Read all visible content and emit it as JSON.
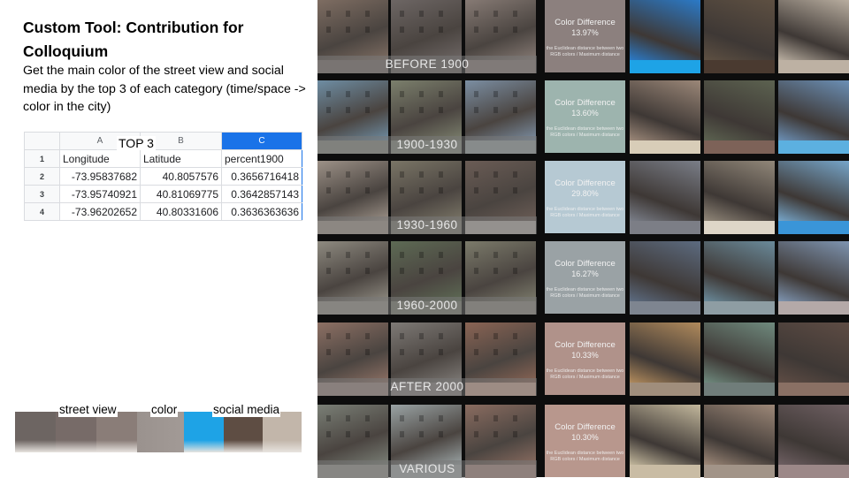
{
  "slide": {
    "title": "Custom Tool: Contribution for Colloquium",
    "description": "Get the main color of the street view and social media by the top 3 of each category (time/space -> color in the city)"
  },
  "sheet": {
    "overlay_label": "TOP 3",
    "columns": [
      "A",
      "B",
      "C"
    ],
    "headers": [
      "Longitude",
      "Latitude",
      "percent1900"
    ],
    "rows": [
      {
        "n": "2",
        "a": "-73.95837682",
        "b": "40.8057576",
        "c": "0.3656716418"
      },
      {
        "n": "3",
        "a": "-73.95740921",
        "b": "40.81069775",
        "c": "0.3642857143"
      },
      {
        "n": "4",
        "a": "-73.96202652",
        "b": "40.80331606",
        "c": "0.3636363636"
      }
    ],
    "header_row": "1"
  },
  "legend": {
    "street_view": "street view",
    "color": "color",
    "social_media": "social media"
  },
  "color_box": {
    "title": "Color Difference",
    "note": "the Euclidean distance between two RGB colors / Maximum distance"
  },
  "rows": [
    {
      "era": "BEFORE 1900",
      "diff": "13.97%",
      "box": "#8c807e",
      "photos": [
        "#7e6d62",
        "#6d6664",
        "#867a74",
        "#2b7ac7",
        "#5e5042",
        "#b8ad9f"
      ],
      "strips": [
        "#7a6f6a",
        "#6b6461",
        "#8a7d78",
        "#1ea3e6",
        "#4a3a30",
        "#bdb1a3"
      ]
    },
    {
      "era": "1900-1930",
      "diff": "13.60%",
      "box": "#9db4ae",
      "photos": [
        "#6e8da3",
        "#7b7f6c",
        "#7b8ea2",
        "#9b8778",
        "#5c6250",
        "#6b8fb5"
      ],
      "strips": [
        "#8a8d83",
        "#868a7e",
        "#9aa3a2",
        "#d8cdb8",
        "#7d6258",
        "#5cb0e0"
      ]
    },
    {
      "era": "1930-1960",
      "diff": "29.80%",
      "box": "#b6c9d3",
      "photos": [
        "#9c9187",
        "#7a7566",
        "#6a5c55",
        "#7a7e88",
        "#918779",
        "#76a5c9"
      ],
      "strips": [
        "#a59a8e",
        "#7f7c72",
        "#b6b0a8",
        "#7c7e86",
        "#ded6c8",
        "#3a95d8"
      ]
    },
    {
      "era": "1960-2000",
      "diff": "16.27%",
      "box": "#9aa2a5",
      "photos": [
        "#8e8a80",
        "#5d6a54",
        "#7b7a6a",
        "#5c6b80",
        "#6a8a9a",
        "#7e94b0"
      ],
      "strips": [
        "#9a968d",
        "#7a7d70",
        "#8f8b80",
        "#7e8590",
        "#8e9da3",
        "#b4a9a8"
      ]
    },
    {
      "era": "AFTER 2000",
      "diff": "10.33%",
      "box": "#b0928a",
      "photos": [
        "#8d7064",
        "#7e7a76",
        "#8a6454",
        "#b08a5c",
        "#6f8a7e",
        "#5e4c44"
      ],
      "strips": [
        "#9e8b83",
        "#8a8480",
        "#c9a593",
        "#a08e7c",
        "#707d7a",
        "#8a7064"
      ]
    },
    {
      "era": "VARIOUS",
      "diff": "10.30%",
      "box": "#b8978d",
      "photos": [
        "#7a7f76",
        "#9aa3a4",
        "#8a6c60",
        "#c2b79c",
        "#9d8878",
        "#6e5f62"
      ],
      "strips": [
        "#9a9890",
        "#a8aeae",
        "#a88a80",
        "#c9bca4",
        "#a29488",
        "#9c8888"
      ]
    }
  ],
  "legend_strip": [
    "#6d6562",
    "#776b68",
    "#8a7d78",
    "#a29a96",
    "#1ea3e6",
    "#5e4d43",
    "#c2b6aa"
  ]
}
